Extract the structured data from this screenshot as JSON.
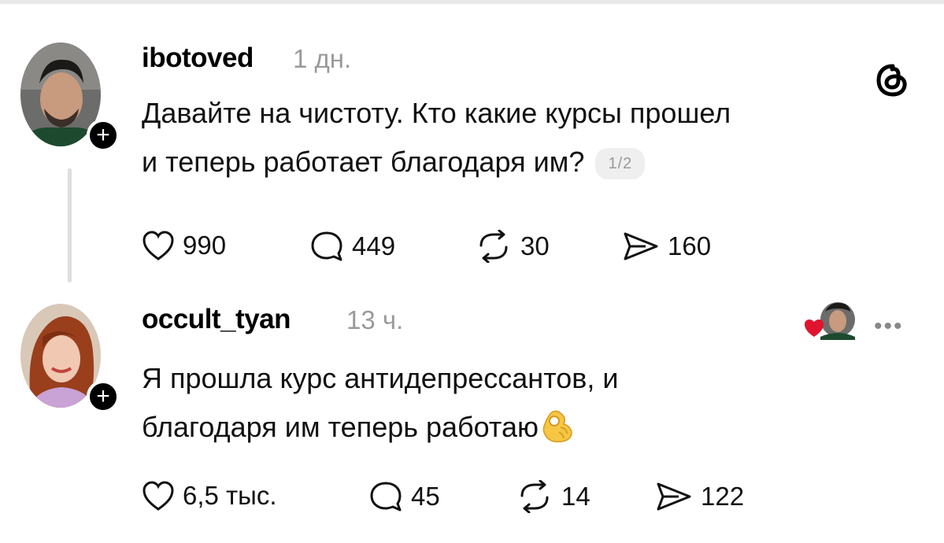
{
  "colors": {
    "text": "#111111",
    "muted": "#9a9a9a",
    "heart": "#e0142f",
    "badge_bg": "#efefef"
  },
  "post": {
    "username": "ibotoved",
    "time": "1 дн.",
    "text_line1": "Давайте на чистоту. Кто какие курсы прошел",
    "text_line2": "и теперь работает благодаря им?",
    "page_badge": "1/2",
    "likes": "990",
    "comments": "449",
    "reposts": "30",
    "shares": "160"
  },
  "reply": {
    "username": "occult_tyan",
    "time": "13 ч.",
    "text_line1": "Я прошла курс антидепрессантов, и",
    "text_line2": "благодаря им теперь работаю",
    "likes": "6,5 тыс.",
    "comments": "45",
    "reposts": "14",
    "shares": "122"
  },
  "icons": [
    "threads-logo-icon",
    "plus-icon",
    "heart-icon",
    "comment-icon",
    "repost-icon",
    "share-icon",
    "more-icon",
    "ok-hand-emoji-icon"
  ]
}
